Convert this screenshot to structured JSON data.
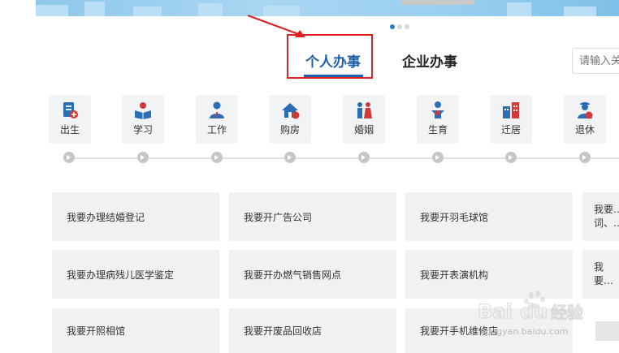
{
  "tabs": {
    "personal": "个人办事",
    "enterprise": "企业办事"
  },
  "search": {
    "placeholder": "请输入关"
  },
  "categories": [
    {
      "label": "出生",
      "icon": "birth-document-icon"
    },
    {
      "label": "学习",
      "icon": "study-book-icon"
    },
    {
      "label": "工作",
      "icon": "work-person-icon"
    },
    {
      "label": "购房",
      "icon": "house-purchase-icon"
    },
    {
      "label": "婚姻",
      "icon": "marriage-couple-icon"
    },
    {
      "label": "生育",
      "icon": "childbirth-icon"
    },
    {
      "label": "迁居",
      "icon": "relocation-building-icon"
    },
    {
      "label": "退休",
      "icon": "retirement-person-icon"
    }
  ],
  "services": [
    [
      "我要办理结婚登记",
      "我要开广告公司",
      "我要开羽毛球馆",
      "我要… 词、…"
    ],
    [
      "我要办理病残儿医学鉴定",
      "我要开办燃气销售网点",
      "我要开表演机构",
      "我要…"
    ],
    [
      "我要开照相馆",
      "我要开废品回收店",
      "我要开手机维修店",
      ""
    ]
  ],
  "watermark": {
    "text": "Bai du 经验",
    "url": "jingyan.baidu.com"
  },
  "colors": {
    "accent": "#1f5fa8",
    "highlight_box": "#e02020",
    "card_bg": "#f0f1f3",
    "icon_blue": "#2a6fb5",
    "icon_red": "#d23a3a"
  }
}
